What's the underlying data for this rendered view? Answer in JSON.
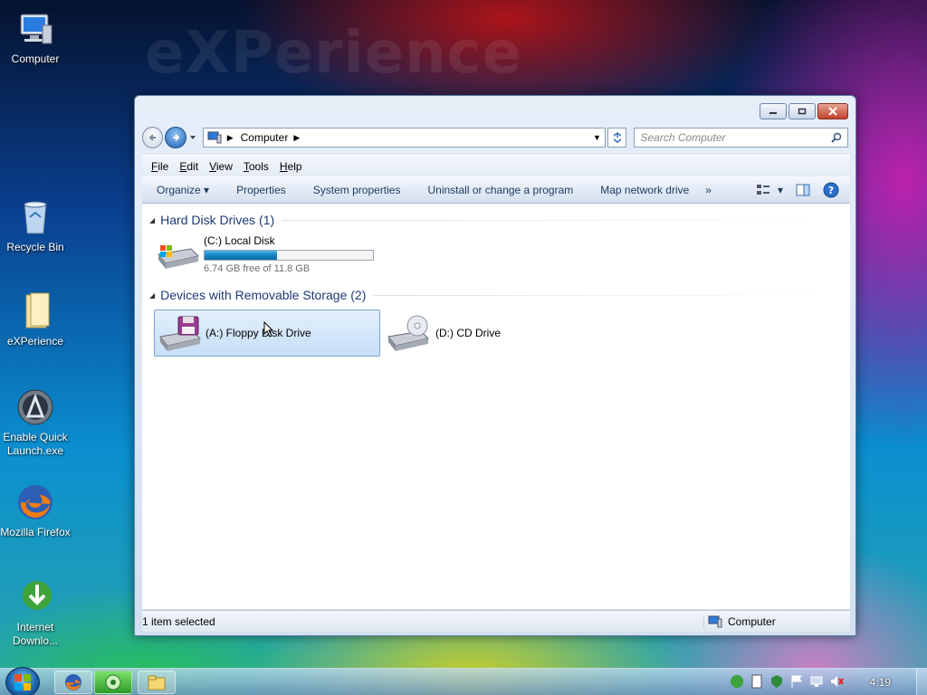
{
  "desktop": {
    "watermark": "eXPerience",
    "icons": [
      {
        "label": "Computer",
        "icon": "computer-icon"
      },
      {
        "label": "Recycle Bin",
        "icon": "recycle-bin-icon"
      },
      {
        "label": "eXPerience",
        "icon": "folder-icon"
      },
      {
        "label": "Enable Quick Launch.exe",
        "icon": "quick-launch-icon"
      },
      {
        "label": "Mozilla Firefox",
        "icon": "firefox-icon"
      },
      {
        "label": "Internet Downlo...",
        "icon": "idm-icon"
      }
    ]
  },
  "window": {
    "address": {
      "location": "Computer"
    },
    "search": {
      "placeholder": "Search Computer"
    },
    "menu": [
      "File",
      "Edit",
      "View",
      "Tools",
      "Help"
    ],
    "commands": [
      "Organize",
      "Properties",
      "System properties",
      "Uninstall or change a program",
      "Map network drive"
    ],
    "more": "»",
    "groups": [
      {
        "title": "Hard Disk Drives (1)",
        "drives": [
          {
            "name": "(C:) Local Disk",
            "free_text": "6.74 GB free of 11.8 GB",
            "used_fraction": 0.43
          }
        ]
      },
      {
        "title": "Devices with Removable Storage (2)",
        "drives": [
          {
            "name": "(A:) Floppy Disk Drive",
            "selected": true
          },
          {
            "name": "(D:) CD Drive"
          }
        ]
      }
    ],
    "status": {
      "selection": "1 item selected",
      "location": "Computer"
    }
  },
  "taskbar": {
    "clock": "4:19",
    "buttons": [
      "firefox-icon",
      "green-app-icon",
      "explorer-icon"
    ]
  },
  "colors": {
    "accent": "#1f62b5",
    "header_text": "#1e3a78",
    "capacity_bar": "#1585c6"
  }
}
